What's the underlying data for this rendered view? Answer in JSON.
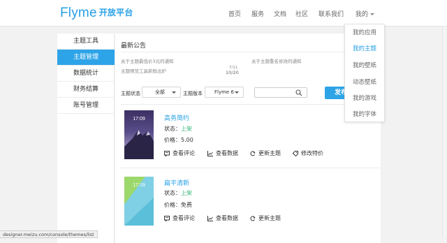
{
  "header": {
    "logo": "Flyme",
    "logo_sub": "开放平台",
    "nav": [
      "首页",
      "服务",
      "文档",
      "社区",
      "联系我们"
    ],
    "user_menu": "我的"
  },
  "sidebar": {
    "items": [
      {
        "label": "主题工具",
        "active": false
      },
      {
        "label": "主题管理",
        "active": true
      },
      {
        "label": "数据统计",
        "active": false
      },
      {
        "label": "财务结算",
        "active": false
      },
      {
        "label": "账号管理",
        "active": false
      }
    ]
  },
  "main": {
    "announcements_title": "最新公告",
    "notices": [
      "关于主题最低价3元的通知",
      "关于主题重名修改的通知",
      "主题预览工具新鲜出炉"
    ],
    "notice_date_top": "7/11",
    "notice_date": "10/20",
    "filter": {
      "status_label": "主题状态",
      "status_value": "全部",
      "version_label": "主题版本",
      "version_value": "Flyme 6",
      "search_placeholder": "",
      "publish_label": "发布"
    },
    "themes": [
      {
        "name": "高务简约",
        "status_label": "状态：",
        "status_value": "上架",
        "price_label": "价格：",
        "price_value": "5.00",
        "thumb_time": "17:09",
        "actions": [
          "查看评论",
          "查看数据",
          "更新主题",
          "修改特价"
        ]
      },
      {
        "name": "扁平清新",
        "status_label": "状态：",
        "status_value": "上架",
        "price_label": "价格：",
        "price_value": "免费",
        "thumb_time": "17:19",
        "actions": [
          "查看评论",
          "查看数据",
          "更新主题"
        ]
      }
    ]
  },
  "dropdown": {
    "items": [
      {
        "label": "我的应用",
        "active": false
      },
      {
        "label": "我的主题",
        "active": true
      },
      {
        "label": "我的壁纸",
        "active": false
      },
      {
        "label": "动态壁纸",
        "active": false
      },
      {
        "label": "我的游戏",
        "active": false
      },
      {
        "label": "我的字体",
        "active": false
      }
    ]
  },
  "statusbar": {
    "url": "designer.meizu.com/console/themes/list"
  },
  "colors": {
    "accent": "#2ea4e8",
    "status_ok": "#3db87a",
    "logo": "#27a0e6"
  }
}
